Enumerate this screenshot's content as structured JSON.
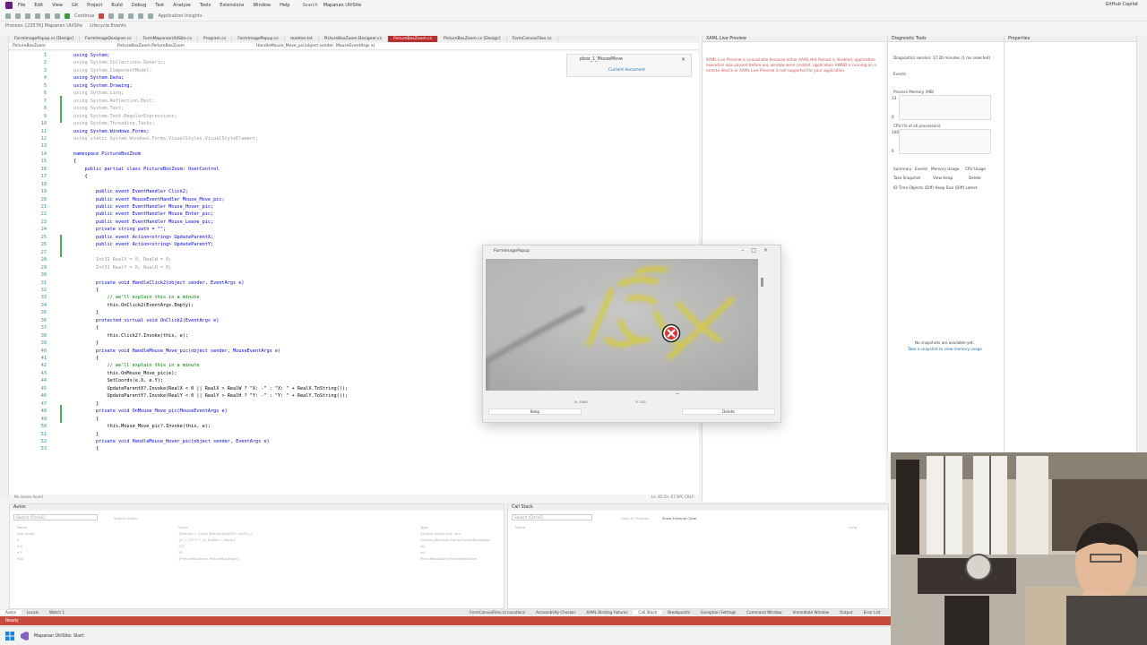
{
  "menubar": {
    "items": [
      "File",
      "Edit",
      "View",
      "Git",
      "Project",
      "Build",
      "Debug",
      "Test",
      "Analyze",
      "Tools",
      "Extensions",
      "Window",
      "Help"
    ],
    "search_label": "Search",
    "solution": "Mapanan UtilSite",
    "copilot": "GitHub Copilot"
  },
  "toolbar": {
    "process_label": "Process: [23576] Mapanan UtilSite",
    "lifecycle_label": "Lifecycle Events",
    "continue_label": "Continue",
    "app_insights": "Application Insights"
  },
  "editor": {
    "tabs": [
      "FormImagePopup.cs [Design]",
      "FormImageDesigner.cs",
      "FormMapananUtilSite.cs",
      "Program.cs",
      "FormImagePopup.cs",
      "readme.txt",
      "PictureBoxZoom.Designer.cs",
      "PictureBoxZoom.cs",
      "PictureBoxZoom.cs [Design]",
      "FormCanvasFiles.cs"
    ],
    "active_tab_index": 7,
    "nav_left": "PictureBoxZoom",
    "nav_mid": "PictureBoxZoom.PictureBoxZoom",
    "nav_right": "HandleMouse_Move_pic(object sender, MouseEventArgs e)",
    "status_left": "No issues found",
    "status_right": "Ln: 45  Ch: 67  SPC  CRLF",
    "lines": [
      {
        "n": "1",
        "t": "using System;"
      },
      {
        "n": "2",
        "t": "using System.Collections.Generic;"
      },
      {
        "n": "3",
        "t": "using System.ComponentModel;"
      },
      {
        "n": "4",
        "t": "using System.Data;"
      },
      {
        "n": "5",
        "t": "using System.Drawing;"
      },
      {
        "n": "6",
        "t": "using System.Linq;"
      },
      {
        "n": "7",
        "t": "using System.Reflection.Emit;"
      },
      {
        "n": "8",
        "t": "using System.Text;"
      },
      {
        "n": "9",
        "t": "using System.Text.RegularExpressions;"
      },
      {
        "n": "10",
        "t": "using System.Threading.Tasks;"
      },
      {
        "n": "11",
        "t": "using System.Windows.Forms;"
      },
      {
        "n": "12",
        "t": "using static System.Windows.Forms.VisualStyles.VisualStyleElement;"
      },
      {
        "n": "13",
        "t": ""
      },
      {
        "n": "14",
        "t": "namespace PictureBoxZoom"
      },
      {
        "n": "15",
        "t": "{"
      },
      {
        "n": "16",
        "t": "    public partial class PictureBoxZoom: UserControl"
      },
      {
        "n": "17",
        "t": "    {"
      },
      {
        "n": "18",
        "t": ""
      },
      {
        "n": "19",
        "t": "        public event EventHandler Click2;"
      },
      {
        "n": "20",
        "t": "        public event MouseEventHandler Mouse_Move_pic;"
      },
      {
        "n": "21",
        "t": "        public event EventHandler Mouse_Hover_pic;"
      },
      {
        "n": "22",
        "t": "        public event EventHandler Mouse_Enter_pic;"
      },
      {
        "n": "23",
        "t": "        public event EventHandler Mouse_Leave_pic;"
      },
      {
        "n": "24",
        "t": "        private string path = \"\";"
      },
      {
        "n": "25",
        "t": "        public event Action<string> UpdateParentX;"
      },
      {
        "n": "26",
        "t": "        public event Action<string> UpdateParentY;"
      },
      {
        "n": "27",
        "t": ""
      },
      {
        "n": "28",
        "t": "        Int32 RealX = 0, RealW = 0;"
      },
      {
        "n": "29",
        "t": "        Int32 RealY = 0, RealH = 0;"
      },
      {
        "n": "30",
        "t": ""
      },
      {
        "n": "31",
        "t": "        private void HandleClick2(object sender, EventArgs e)"
      },
      {
        "n": "32",
        "t": "        {"
      },
      {
        "n": "33",
        "t": "            // we'll explain this in a minute"
      },
      {
        "n": "34",
        "t": "            this.OnClick2(EventArgs.Empty);"
      },
      {
        "n": "35",
        "t": "        }"
      },
      {
        "n": "36",
        "t": "        protected virtual void OnClick2(EventArgs e)"
      },
      {
        "n": "37",
        "t": "        {"
      },
      {
        "n": "38",
        "t": "            this.Click2?.Invoke(this, e);"
      },
      {
        "n": "39",
        "t": "        }"
      },
      {
        "n": "40",
        "t": "        private void HandleMouse_Move_pic(object sender, MouseEventArgs e)"
      },
      {
        "n": "41",
        "t": "        {"
      },
      {
        "n": "42",
        "t": "            // we'll explain this in a minute"
      },
      {
        "n": "43",
        "t": "            this.OnMouse_Move_pic(e);"
      },
      {
        "n": "44",
        "t": "            SetCoords(e.X, e.Y);"
      },
      {
        "n": "45",
        "t": "            UpdateParentX?.Invoke(RealX < 0 || RealX > RealW ? \"X: -\" : \"X: \" + RealX.ToString());"
      },
      {
        "n": "46",
        "t": "            UpdateParentY?.Invoke(RealY < 0 || RealY > RealH ? \"Y: -\" : \"Y: \" + RealY.ToString());"
      },
      {
        "n": "47",
        "t": "        }"
      },
      {
        "n": "48",
        "t": "        private void OnMouse_Move_pic(MouseEventArgs e)"
      },
      {
        "n": "49",
        "t": "        {"
      },
      {
        "n": "50",
        "t": "            this.Mouse_Move_pic?.Invoke(this, e);"
      },
      {
        "n": "51",
        "t": "        }"
      },
      {
        "n": "52",
        "t": "        private void HandleMouse_Hover_pic(object sender, EventArgs e)"
      },
      {
        "n": "53",
        "t": "        {"
      }
    ]
  },
  "find_popup": {
    "title": "pbox_1_MouseMove",
    "scope": "Current document"
  },
  "xaml_panel": {
    "title": "XAML Live Preview",
    "message": "XAML Live Preview is unavailable because either XAML Hot Reload is disabled, application execution was paused before any window were created, application HWND is running on a remote device or XAML Live Preview is not supported for your application."
  },
  "diagnostics": {
    "title": "Diagnostic Tools",
    "session": "Diagnostics session: 17:20 minutes (1 ms selected)",
    "events": "Events",
    "process_memory": "Process Memory (MB)",
    "cpu": "CPU (% of all processors)",
    "tabs": [
      "Summary",
      "Events",
      "Memory Usage",
      "CPU Usage"
    ],
    "take_snapshot": "Take Snapshot",
    "view_heap": "View Heap",
    "delete": "Delete",
    "columns": "ID  Time  Objects (Diff)  Heap Size (Diff)  Latest",
    "no_snapshots": "No snapshots are available yet.",
    "no_snapshots_link": "Take a snapshot to view memory usage",
    "mem_max": "13",
    "mem_min": "0",
    "cpu_max": "100",
    "cpu_min": "0"
  },
  "props_panel": {
    "title": "Properties"
  },
  "autos": {
    "title": "Autos",
    "search": "Search (Ctrl+E)",
    "search_depth": "Search Depth:",
    "columns": [
      "Name",
      "Value",
      "Type"
    ],
    "rows": [
      {
        "name": "SetCoords",
        "value": "{Method = {Void SetCoords(Int32, Int32)}}",
        "type": "System.Action<int, int>"
      },
      {
        "name": "e",
        "value": "{X = 137 Y = 11 Button = None}",
        "type": "System.Windows.Forms.MouseEventArgs"
      },
      {
        "name": "e.X",
        "value": "137",
        "type": "int"
      },
      {
        "name": "e.Y",
        "value": "11",
        "type": "int"
      },
      {
        "name": "this",
        "value": "{PictureBoxZoom.PictureBoxZoom}",
        "type": "PictureBoxZoom.PictureBoxZoom"
      }
    ]
  },
  "callstack": {
    "title": "Call Stack",
    "search": "Search (Ctrl+E)",
    "view_all": "View all Threads",
    "show_external": "Show External Code",
    "columns": [
      "Name",
      "Lang"
    ]
  },
  "bottom_tabs": {
    "left": [
      "Autos",
      "Locals",
      "Watch 1"
    ],
    "right": [
      "FormCanvasFiles.cs Locations",
      "Accessibility Checker",
      "XAML Binding Failures",
      "Call Stack",
      "Breakpoints",
      "Exception Settings",
      "Command Window",
      "Immediate Window",
      "Output",
      "Error List"
    ]
  },
  "status_bar": {
    "text": "Ready"
  },
  "taskbar": {
    "app": "Mapanan UtilSite: Start"
  },
  "dialog": {
    "title": "FormImagePopup",
    "coord_x": "X: 3584",
    "coord_y": "Y: 320",
    "keep_label": "Keep",
    "delete_label": "Delete",
    "image_subject": "yellow handwritten marks on grey concrete, magnified",
    "cursor": "close-circle cursor"
  },
  "colors": {
    "accent": "#b92f2f",
    "status_bar": "#c84a3c",
    "keyword": "#0000ff",
    "type": "#2b91af"
  }
}
